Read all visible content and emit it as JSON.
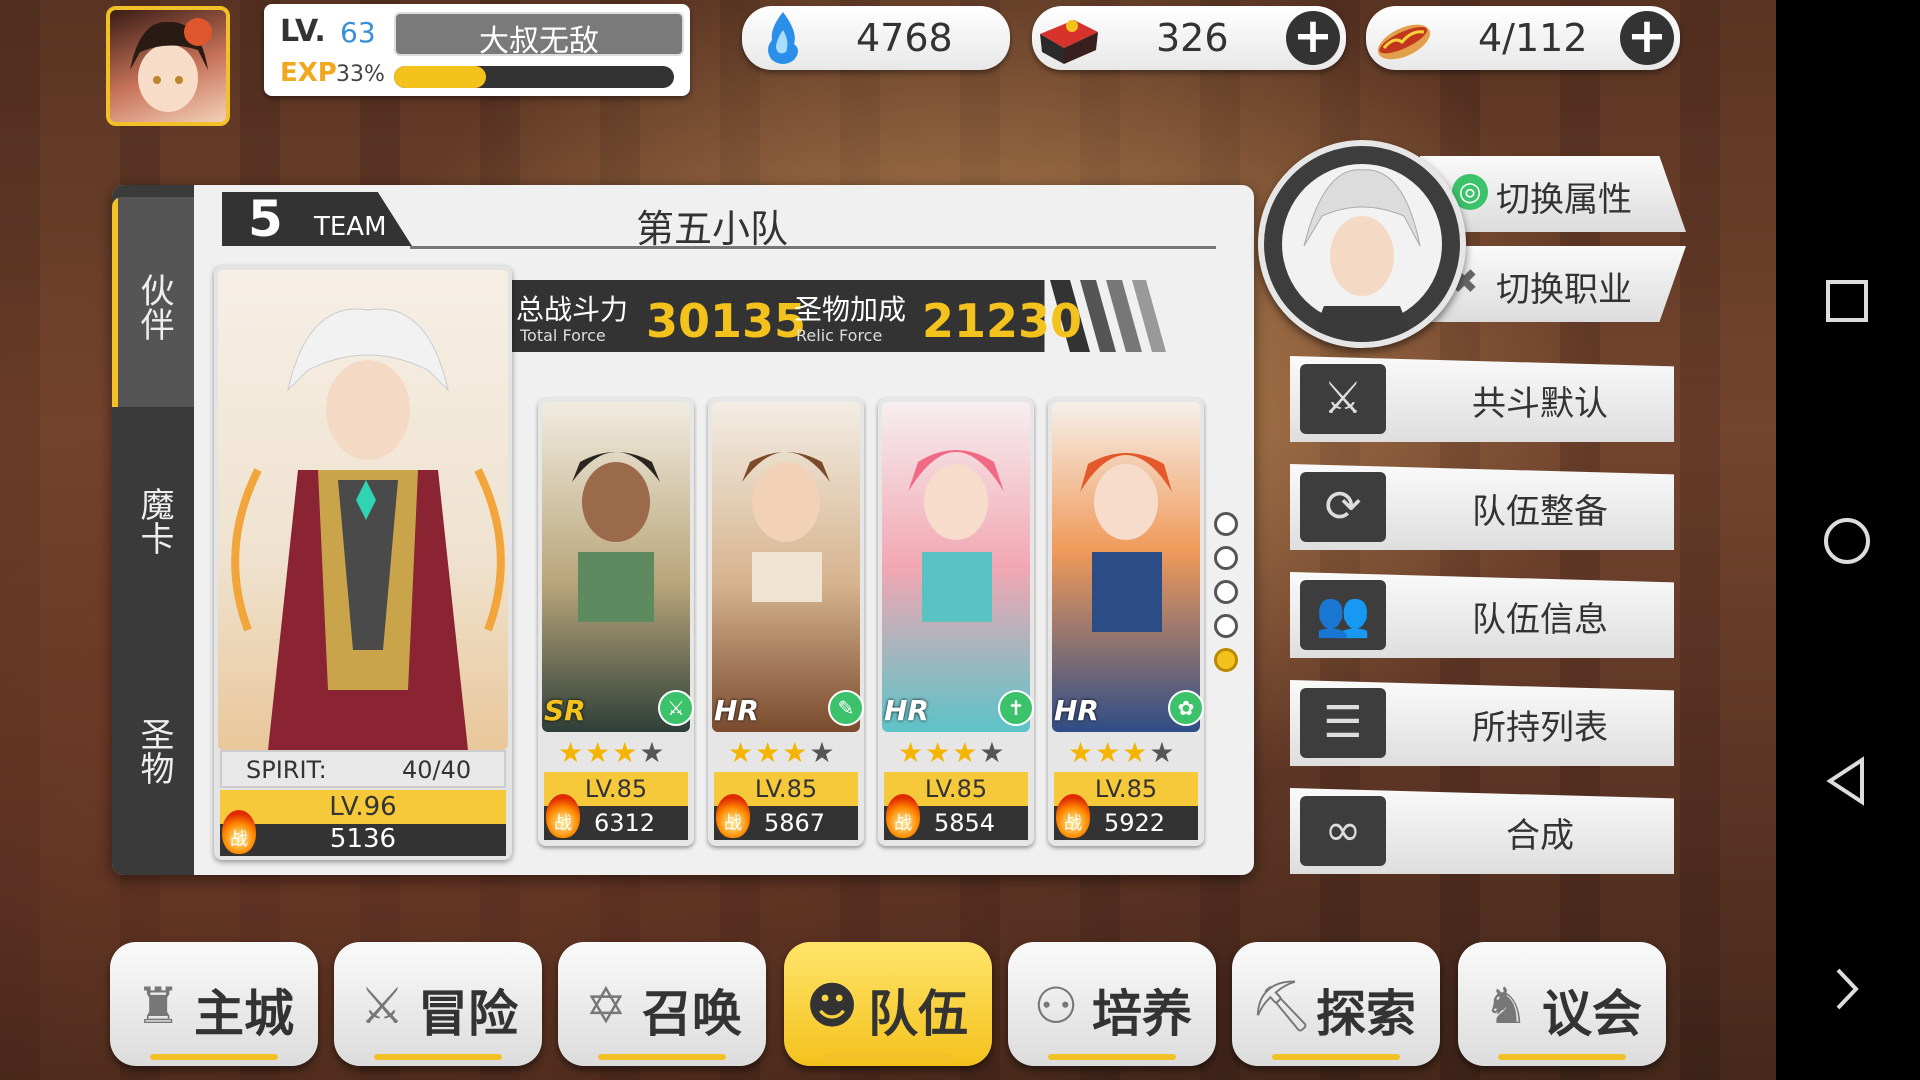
{
  "player": {
    "level_label": "LV.",
    "level_value": "63",
    "name": "大叔无敌",
    "exp_label": "EXP",
    "exp_percent_text": "33%",
    "exp_fraction": 0.33
  },
  "resources": [
    {
      "icon": "blue-flame-icon",
      "value": "4768",
      "has_plus": false
    },
    {
      "icon": "treasure-chest-icon",
      "value": "326",
      "has_plus": true
    },
    {
      "icon": "hotdog-icon",
      "value": "4/112",
      "has_plus": true
    }
  ],
  "side_tabs": [
    "伙伴",
    "魔卡",
    "圣物"
  ],
  "team": {
    "number": "5",
    "team_label": "TEAM",
    "name": "第五小队",
    "total_force_label": "总战斗力",
    "total_force_sub": "Total Force",
    "total_force_value": "30135",
    "relic_force_label": "圣物加成",
    "relic_force_sub": "Relic Force",
    "relic_force_value": "21230"
  },
  "leader": {
    "spirit_label": "SPIRIT:",
    "spirit_value": "40/40",
    "level": "LV.96",
    "power": "5136",
    "power_icon_text": "战"
  },
  "members": [
    {
      "rarity": "SR",
      "stars": 3,
      "max_stars": 4,
      "level": "LV.85",
      "power": "6312",
      "power_icon_text": "战"
    },
    {
      "rarity": "HR",
      "stars": 3,
      "max_stars": 4,
      "level": "LV.85",
      "power": "5867",
      "power_icon_text": "战"
    },
    {
      "rarity": "HR",
      "stars": 3,
      "max_stars": 4,
      "level": "LV.85",
      "power": "5854",
      "power_icon_text": "战"
    },
    {
      "rarity": "HR",
      "stars": 3,
      "max_stars": 4,
      "level": "LV.85",
      "power": "5922",
      "power_icon_text": "战"
    }
  ],
  "page_dots": {
    "count": 5,
    "active_index": 4
  },
  "switch_buttons": {
    "attribute": "切换属性",
    "job": "切换职业"
  },
  "right_menu": [
    {
      "label": "共斗默认",
      "icon": "crossed-swords-icon"
    },
    {
      "label": "队伍整备",
      "icon": "cycle-icon"
    },
    {
      "label": "队伍信息",
      "icon": "team-info-icon"
    },
    {
      "label": "所持列表",
      "icon": "list-icon"
    },
    {
      "label": "合成",
      "icon": "infinity-icon"
    }
  ],
  "bottom_nav": [
    {
      "label": "主城",
      "icon": "castle-icon",
      "active": false
    },
    {
      "label": "冒险",
      "icon": "swords-icon",
      "active": false
    },
    {
      "label": "召唤",
      "icon": "summon-star-icon",
      "active": false
    },
    {
      "label": "队伍",
      "icon": "team-mask-icon",
      "active": true
    },
    {
      "label": "培养",
      "icon": "train-icon",
      "active": false
    },
    {
      "label": "探索",
      "icon": "explore-icon",
      "active": false
    },
    {
      "label": "议会",
      "icon": "council-icon",
      "active": false
    }
  ],
  "colors": {
    "accent": "#f4c21d",
    "panel": "#f0f0f0",
    "dark": "#3a3a3a",
    "power_orange": "#ff8a00",
    "type_green": "#3cc26a"
  }
}
